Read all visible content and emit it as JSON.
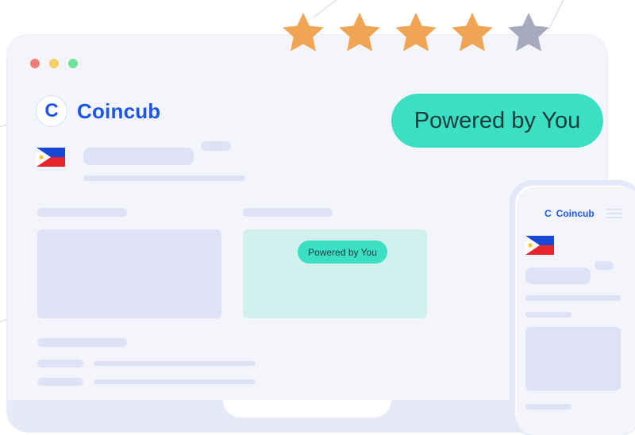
{
  "window": {
    "traffic_lights": [
      {
        "name": "close",
        "color": "#f07d7d"
      },
      {
        "name": "minimize",
        "color": "#f6d067"
      },
      {
        "name": "zoom",
        "color": "#6ee39b"
      }
    ]
  },
  "brand": {
    "logo_letter": "C",
    "name": "Coincub"
  },
  "badge_large": {
    "label": "Powered by You"
  },
  "card_badge": {
    "label": "Powered by You"
  },
  "phone": {
    "brand": {
      "logo_letter": "C",
      "name": "Coincub"
    }
  },
  "rating": {
    "value": 4,
    "max": 5,
    "filled_color": "#f0a555",
    "empty_color": "#a7a9bd"
  },
  "colors": {
    "accent": "#1a56f0",
    "teal": "#3be0c4",
    "skeleton": "#dfe2f6",
    "background": "#f4f5fb"
  },
  "icons": {
    "logo": "coincub-logo-icon",
    "flag": "philippines-flag-icon",
    "menu": "hamburger-menu-icon",
    "star": "star-icon"
  }
}
